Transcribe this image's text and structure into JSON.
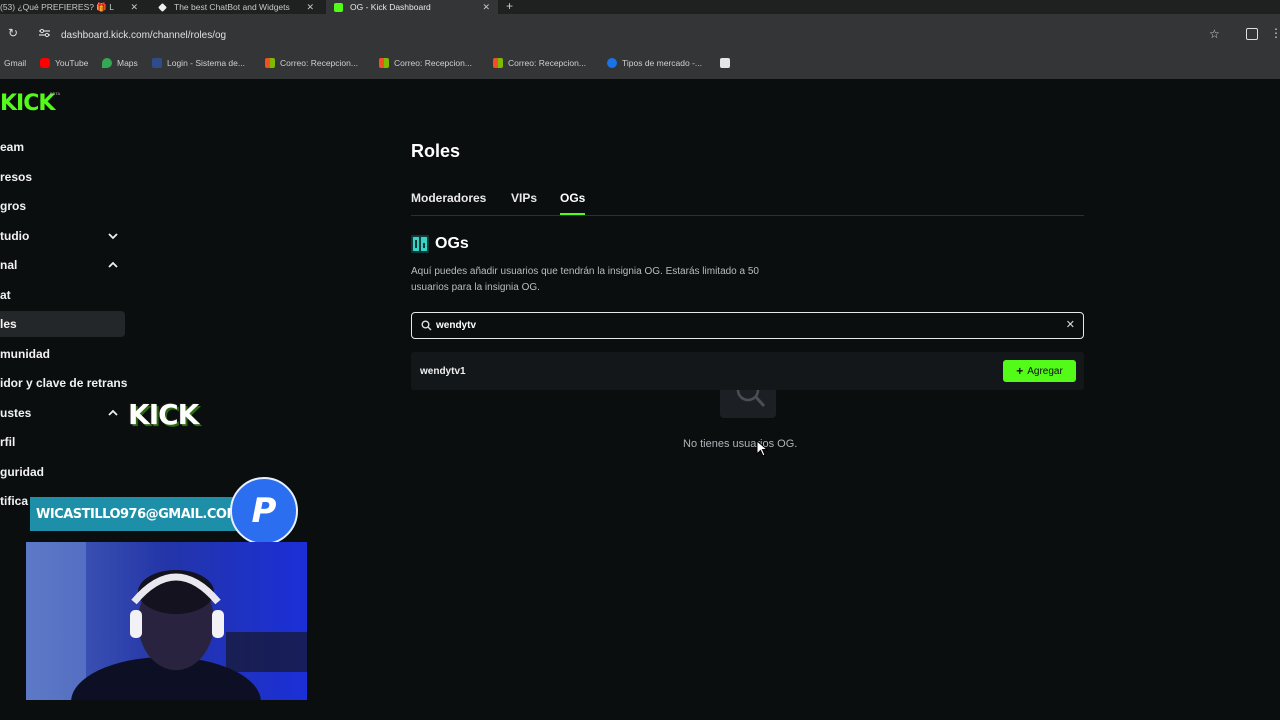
{
  "browser": {
    "tabs": [
      {
        "title": "(53) ¿Qué PREFIERES? 🎁 L"
      },
      {
        "title": "The best ChatBot and Widgets"
      },
      {
        "title": "OG - Kick Dashboard"
      }
    ],
    "url": "dashboard.kick.com/channel/roles/og",
    "bookmarks": [
      {
        "label": "Gmail"
      },
      {
        "label": "YouTube"
      },
      {
        "label": "Maps"
      },
      {
        "label": "Login - Sistema de..."
      },
      {
        "label": "Correo: Recepcion..."
      },
      {
        "label": "Correo: Recepcion..."
      },
      {
        "label": "Correo: Recepcion..."
      },
      {
        "label": "Tipos de mercado -..."
      }
    ]
  },
  "logo": {
    "text": "KICK",
    "beta": "BETA"
  },
  "sidebar": {
    "items": [
      {
        "label": "eam"
      },
      {
        "label": "resos"
      },
      {
        "label": "gros"
      },
      {
        "label": "tudio"
      },
      {
        "label": "nal"
      },
      {
        "label": "at"
      },
      {
        "label": "les"
      },
      {
        "label": "munidad"
      },
      {
        "label": "idor y clave de retrans"
      },
      {
        "label": "ustes"
      },
      {
        "label": "rfil"
      },
      {
        "label": "guridad"
      },
      {
        "label": "tifica"
      }
    ]
  },
  "main": {
    "title": "Roles",
    "tabs": [
      {
        "label": "Moderadores"
      },
      {
        "label": "VIPs"
      },
      {
        "label": "OGs"
      }
    ],
    "section_title": "OGs",
    "description": "Aquí puedes añadir usuarios que tendrán la insignia OG. Estarás limitado a 50 usuarios para la insignia OG.",
    "search": {
      "value": "wendytv"
    },
    "result": {
      "username": "wendytv1",
      "add_label": "Agregar"
    },
    "empty_text": "No tienes usuarios OG."
  },
  "overlay": {
    "kick_text": "KICK",
    "email": "WICASTILLO976@GMAIL.COM"
  },
  "colors": {
    "accent": "#53fc18",
    "background": "#0b0e0f",
    "email_bar": "#1e8fa8",
    "paypal": "#2b6ff0"
  }
}
